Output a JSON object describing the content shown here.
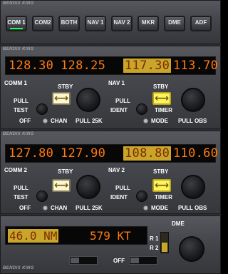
{
  "audio_panel": {
    "brand": "BENDIX KING",
    "buttons": [
      {
        "label": "COM 1",
        "active": true
      },
      {
        "label": "COM2",
        "active": false
      },
      {
        "label": "BOTH",
        "active": false
      },
      {
        "label": "NAV 1",
        "active": false
      },
      {
        "label": "NAV 2",
        "active": false
      },
      {
        "label": "MKR",
        "active": false
      },
      {
        "label": "DME",
        "active": false
      },
      {
        "label": "ADF",
        "active": false
      }
    ]
  },
  "radio1": {
    "brand": "BENDIX KING",
    "com_active": "128.30",
    "com_standby": "128.25",
    "nav_active": "117.30",
    "nav_standby": "113.70",
    "com_label": "COMM 1",
    "nav_label": "NAV 1",
    "stby_label": "STBY",
    "pull": "PULL",
    "test": "TEST",
    "off": "OFF",
    "chan": "CHAN",
    "pull_25k": "PULL 25K",
    "ident": "IDENT",
    "timer": "TIMER",
    "mode": "MODE",
    "pull_obs": "PULL OBS",
    "swap_glyph": "⟷"
  },
  "radio2": {
    "brand": "BENDIX KING",
    "com_active": "127.80",
    "com_standby": "127.90",
    "nav_active": "108.80",
    "nav_standby": "110.60",
    "com_label": "COMM 2",
    "nav_label": "NAV 2",
    "stby_label": "STBY",
    "pull": "PULL",
    "test": "TEST",
    "off": "OFF",
    "chan": "CHAN",
    "pull_25k": "PULL 25K",
    "ident": "IDENT",
    "timer": "TIMER",
    "mode": "MODE",
    "pull_obs": "PULL OBS",
    "swap_glyph": "⟷"
  },
  "dme": {
    "brand": "BENDIX KING",
    "distance": "46.0 NM",
    "speed": "579 KT",
    "title": "DME",
    "r1": "R 1",
    "r2": "R 2",
    "off": "OFF"
  },
  "colors": {
    "segment_orange": "#ff7a12",
    "highlight_amber": "#c9a62a",
    "swap_button_lit": "#fff35a",
    "led_green": "#1eff4c"
  }
}
